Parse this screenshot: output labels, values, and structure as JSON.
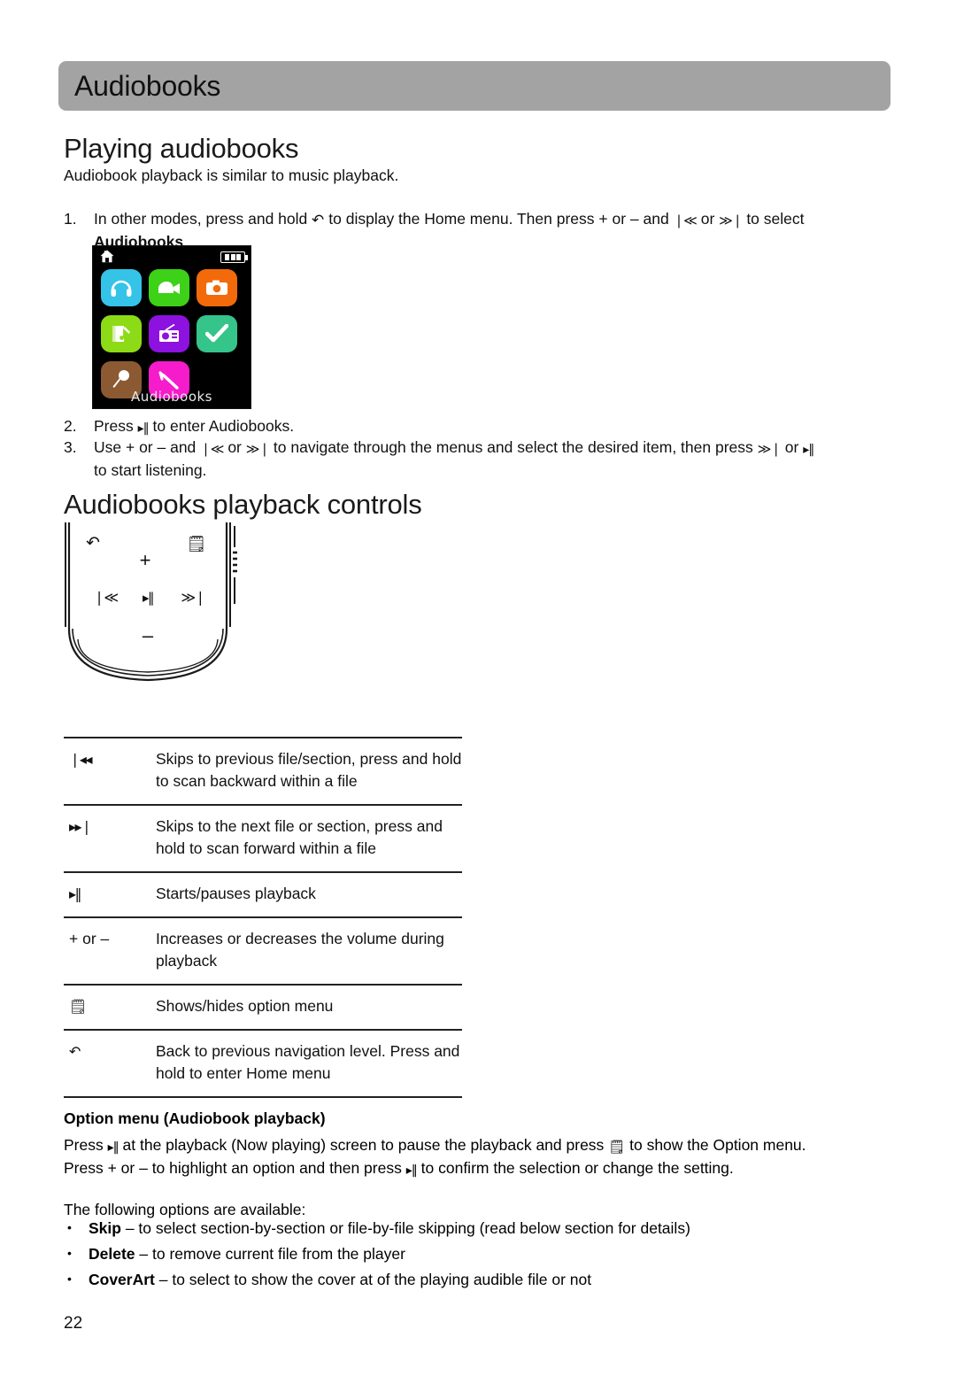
{
  "chapter": {
    "title": "Audiobooks"
  },
  "sections": {
    "playing": {
      "heading": "Playing audiobooks",
      "intro": "Audiobook playback is similar to music playback."
    },
    "controls": {
      "heading": "Audiobooks playback controls"
    }
  },
  "steps": [
    {
      "num": "1.",
      "part1": "In other modes, press and hold",
      "icon1": "back-icon",
      "part2": "to display the Home menu. Then press + or – and",
      "icon2": "prev-icon",
      "part3": "or",
      "icon3": "next-icon",
      "part4": "to select",
      "bold": "Audiobooks",
      "part5": "."
    },
    {
      "num": "2.",
      "part1": "Press",
      "icon1": "play-pause-icon",
      "part2": "to enter Audiobooks."
    },
    {
      "num": "3.",
      "part1": "Use  + or – and",
      "icon1": "prev-icon",
      "part2": "or",
      "icon2": "next-icon",
      "part3": "to navigate through the menus and select the desired item, then press",
      "icon3": "next-icon",
      "part4": "or",
      "icon4": "play-pause-icon",
      "part5": "to start listening."
    }
  ],
  "device_screen": {
    "status_icon": "home-icon",
    "battery_icon": "battery-icon",
    "selected_label": "Audiobooks",
    "icons": [
      {
        "name": "music-icon",
        "color": "#35c3e8"
      },
      {
        "name": "video-icon",
        "color": "#3dd118"
      },
      {
        "name": "photo-icon",
        "color": "#f26a0a"
      },
      {
        "name": "audiobooks-icon",
        "color": "#8ddb16"
      },
      {
        "name": "radio-icon",
        "color": "#8d12df"
      },
      {
        "name": "tasks-icon",
        "color": "#35c48a"
      },
      {
        "name": "voice-record-icon",
        "color": "#8b5a33"
      },
      {
        "name": "tools-icon",
        "color": "#f61bcb"
      }
    ]
  },
  "player_art": {
    "buttons": [
      {
        "name": "back-button",
        "glyph": "back"
      },
      {
        "name": "volume-up-button",
        "glyph": "+"
      },
      {
        "name": "option-button",
        "glyph": "option"
      },
      {
        "name": "previous-button",
        "glyph": "prev"
      },
      {
        "name": "play-pause-button",
        "glyph": "playpause"
      },
      {
        "name": "next-button",
        "glyph": "next"
      },
      {
        "name": "volume-down-button",
        "glyph": "–"
      }
    ]
  },
  "controls_table": [
    {
      "key": "prev-icon",
      "key_text": "",
      "desc": "Skips to previous file/section, press and hold to scan backward within a file"
    },
    {
      "key": "next-icon",
      "key_text": "",
      "desc": "Skips to the next file or section, press and hold to scan forward within a file"
    },
    {
      "key": "play-pause-icon",
      "key_text": "",
      "desc": "Starts/pauses playback"
    },
    {
      "key": "volume-keys",
      "key_text": "+ or –",
      "desc": "Increases or decreases the volume during playback"
    },
    {
      "key": "option-icon",
      "key_text": "",
      "desc": "Shows/hides option menu"
    },
    {
      "key": "back-icon",
      "key_text": "",
      "desc": "Back to previous navigation level. Press and hold to enter Home menu"
    }
  ],
  "option_menu": {
    "heading": "Option menu (Audiobook playback)",
    "line1_a": "Press",
    "line1_icon1": "play-pause-icon",
    "line1_b": "at the playback (Now playing) screen to pause the playback and press",
    "line1_icon2": "option-icon",
    "line1_c": "to show the Option menu.",
    "line2_a": "Press + or – to highlight an option and then press",
    "line2_icon": "play-pause-icon",
    "line2_b": "to confirm the selection or change the setting.",
    "available": "The following options are available:",
    "options": [
      {
        "term": "Skip",
        "desc": " – to select section-by-section or file-by-file skipping (read below section for details)"
      },
      {
        "term": "Delete",
        "desc": " – to remove current file from the player"
      },
      {
        "term": "CoverArt",
        "desc": " – to select to show the cover at of the playing audible file or not"
      }
    ]
  },
  "footer": {
    "page_number": "22"
  },
  "colors": {
    "chapter_bar": "#a3a3a3",
    "text": "#111111",
    "rule": "#222222"
  }
}
